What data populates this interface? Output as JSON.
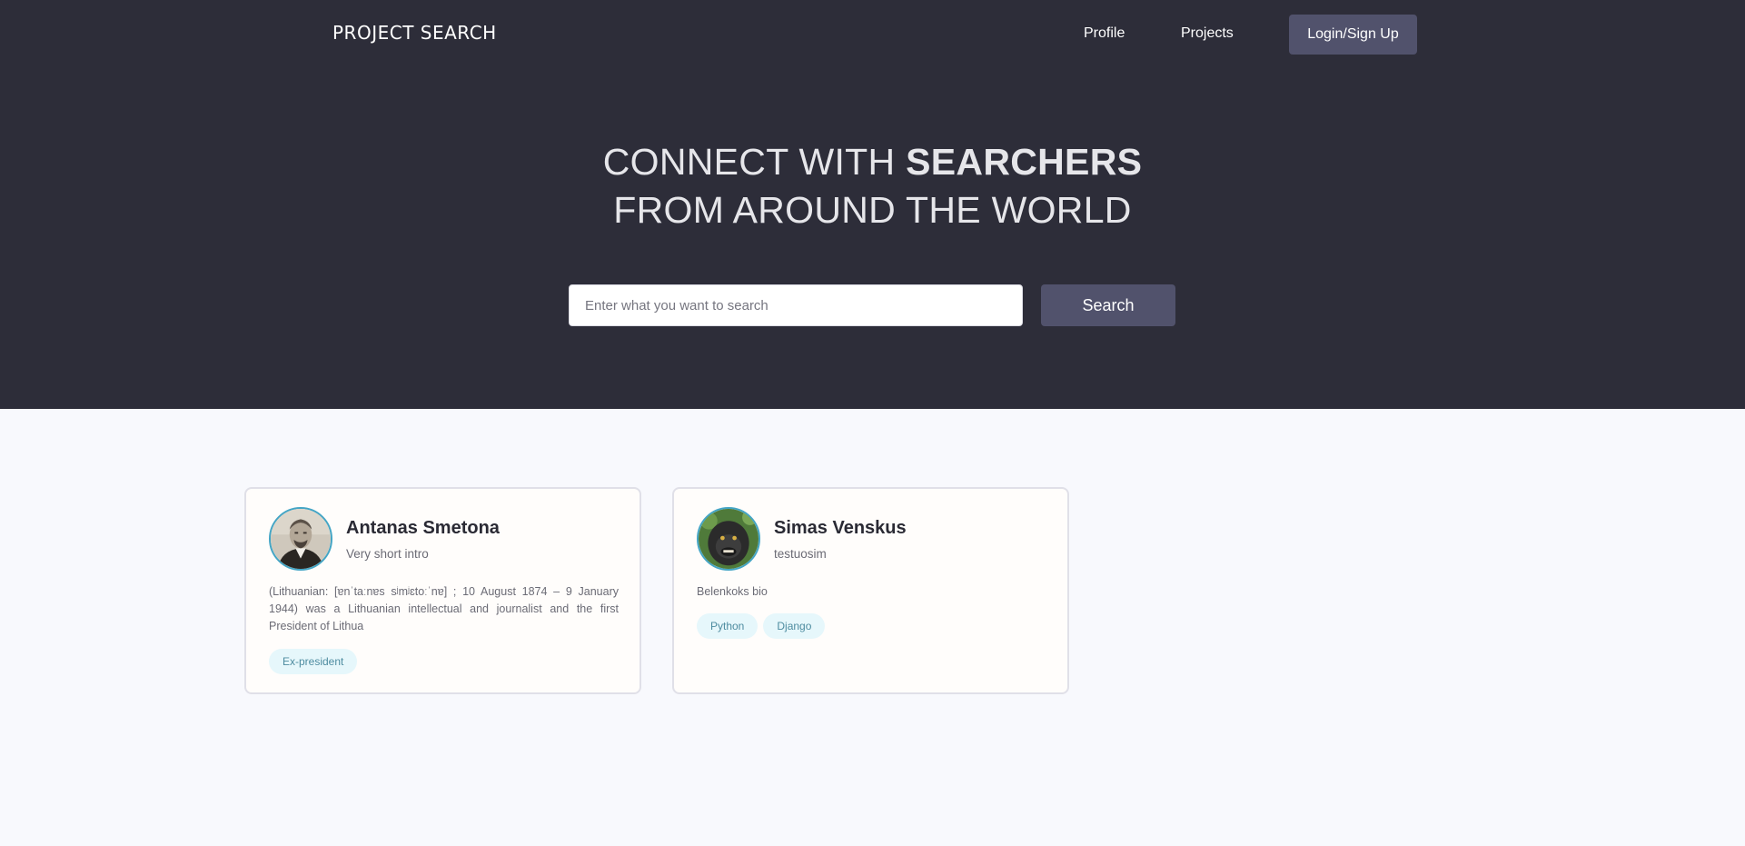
{
  "header": {
    "logo": "PROJECT SEARCH",
    "nav": [
      {
        "label": "Profile"
      },
      {
        "label": "Projects"
      }
    ],
    "login_label": "Login/Sign Up"
  },
  "hero": {
    "line1_prefix": "CONNECT WITH ",
    "line1_bold": "SEARCHERS",
    "line2": "FROM AROUND THE WORLD"
  },
  "search": {
    "placeholder": "Enter what you want to search",
    "value": "",
    "button_label": "Search"
  },
  "cards": [
    {
      "name": "Antanas Smetona",
      "intro": "Very short intro",
      "bio": "(Lithuanian: [ɐnˈtaːnɐs sʲmʲɛtoːˈnɐ] ; 10 August 1874 – 9 January 1944) was a Lithuanian intellectual and journalist and the first President of Lithua",
      "tags": [
        "Ex-president"
      ]
    },
    {
      "name": "Simas Venskus",
      "intro": "testuosim",
      "bio": "Belenkoks bio",
      "tags": [
        "Python",
        "Django"
      ]
    }
  ],
  "colors": {
    "hero_bg": "#2d2d39",
    "accent_button": "#51526c",
    "page_bg": "#f8f9fd",
    "avatar_ring": "#43a5c5",
    "tag_bg": "#e6f7fb"
  }
}
